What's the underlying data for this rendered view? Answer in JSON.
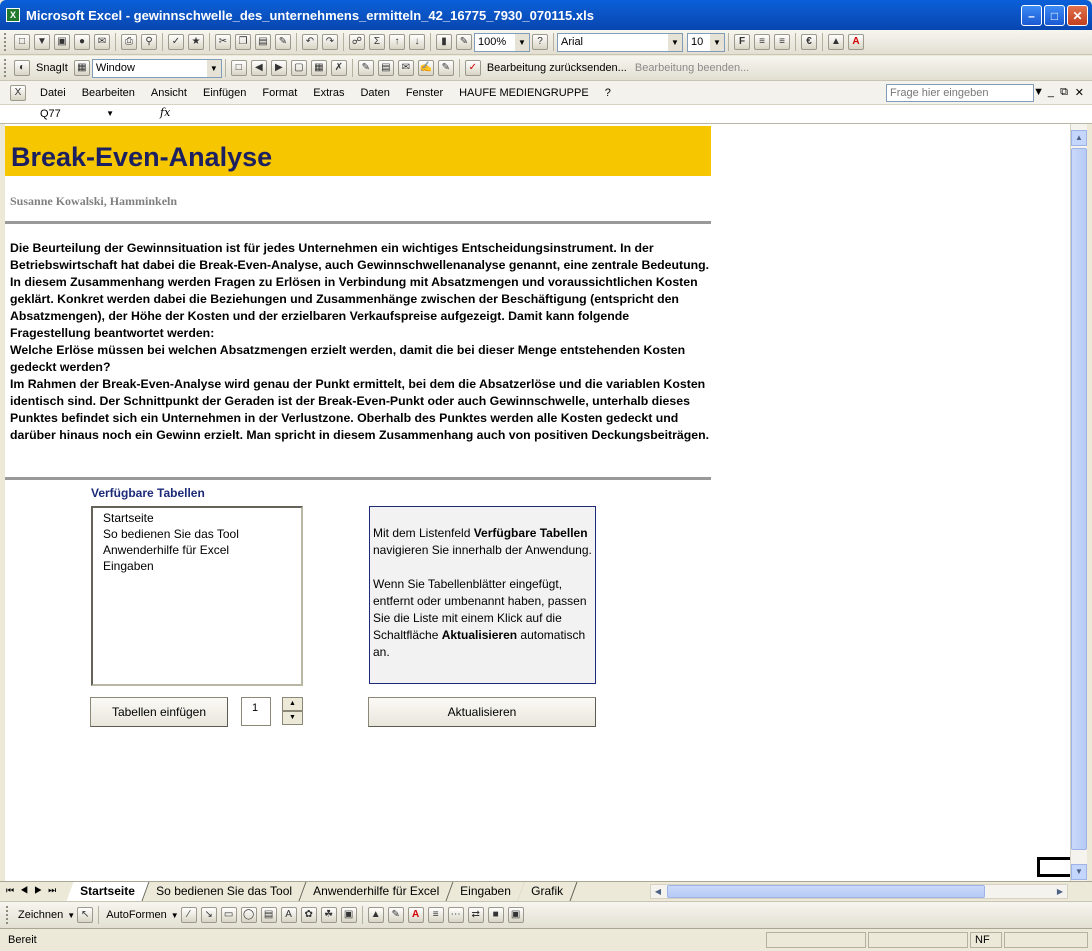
{
  "window": {
    "title": "Microsoft Excel - gewinnschwelle_des_unternehmens_ermitteln_42_16775_7930_070115.xls",
    "app_icon": "excel-icon"
  },
  "standard_toolbar": {
    "zoom": "100%",
    "font_name": "Arial",
    "font_size": "10",
    "bold": "F",
    "euro": "€"
  },
  "snagit_toolbar": {
    "snagit_label": "SnagIt",
    "capture_mode": "Window",
    "review_reply": "Bearbeitung zurücksenden...",
    "review_end": "Bearbeitung beenden..."
  },
  "menu": {
    "items": [
      "Datei",
      "Bearbeiten",
      "Ansicht",
      "Einfügen",
      "Format",
      "Extras",
      "Daten",
      "Fenster",
      "HAUFE MEDIENGRUPPE",
      "?"
    ],
    "help_placeholder": "Frage hier eingeben"
  },
  "formula_bar": {
    "name_box": "Q77",
    "fx": "fx"
  },
  "sheet": {
    "title": "Break-Even-Analyse",
    "author": "Susanne Kowalski, Hamminkeln",
    "intro": [
      "Die Beurteilung der Gewinnsituation ist für jedes Unternehmen ein wichtiges Entscheidungsinstrument. In der Betriebswirtschaft hat dabei die Break-Even-Analyse, auch Gewinnschwellenanalyse genannt, eine zentrale Bedeutung. In diesem Zusammenhang werden Fragen zu Erlösen in Verbindung mit Absatzmengen und voraussichtlichen Kosten geklärt. Konkret werden dabei die Beziehungen und Zusammenhänge zwischen der Beschäftigung (entspricht den Absatzmengen), der Höhe der Kosten und der erzielbaren Verkaufspreise aufgezeigt. Damit kann folgende Fragestellung beantwortet werden:",
      "Welche Erlöse müssen bei welchen Absatzmengen erzielt werden, damit die bei dieser Menge entstehenden Kosten gedeckt werden?",
      "Im Rahmen der Break-Even-Analyse wird genau der Punkt ermittelt, bei dem die Absatzerlöse und die variablen Kosten identisch sind. Der Schnittpunkt der Geraden ist der Break-Even-Punkt oder auch Gewinnschwelle, unterhalb dieses Punktes befindet sich ein Unternehmen in der Verlustzone. Oberhalb des Punktes werden alle Kosten gedeckt und darüber hinaus noch ein Gewinn erzielt. Man spricht in diesem Zusammenhang auch von positiven Deckungsbeiträgen."
    ],
    "list_caption": "Verfügbare Tabellen",
    "list_items": [
      "Startseite",
      "So bedienen Sie das Tool",
      "Anwenderhilfe für Excel",
      "Eingaben"
    ],
    "info": {
      "p1_pre": "Mit dem Listenfeld ",
      "p1_bold": "Verfügbare Tabellen",
      "p1_post": " navigieren Sie innerhalb der Anwendung.",
      "p2_pre": "Wenn Sie Tabellenblätter eingefügt, entfernt oder umbenannt haben, passen Sie die Liste mit einem Klick auf die Schaltfläche ",
      "p2_bold": "Aktualisieren",
      "p2_post": " automatisch an."
    },
    "insert_button": "Tabellen einfügen",
    "spin_value": "1",
    "refresh_button": "Aktualisieren"
  },
  "tabs": [
    "Startseite",
    "So bedienen Sie das Tool",
    "Anwenderhilfe für Excel",
    "Eingaben",
    "Grafik"
  ],
  "active_tab": "Startseite",
  "draw_toolbar": {
    "draw_label": "Zeichnen",
    "autoshapes_label": "AutoFormen"
  },
  "status": {
    "text": "Bereit",
    "mode": "NF"
  }
}
